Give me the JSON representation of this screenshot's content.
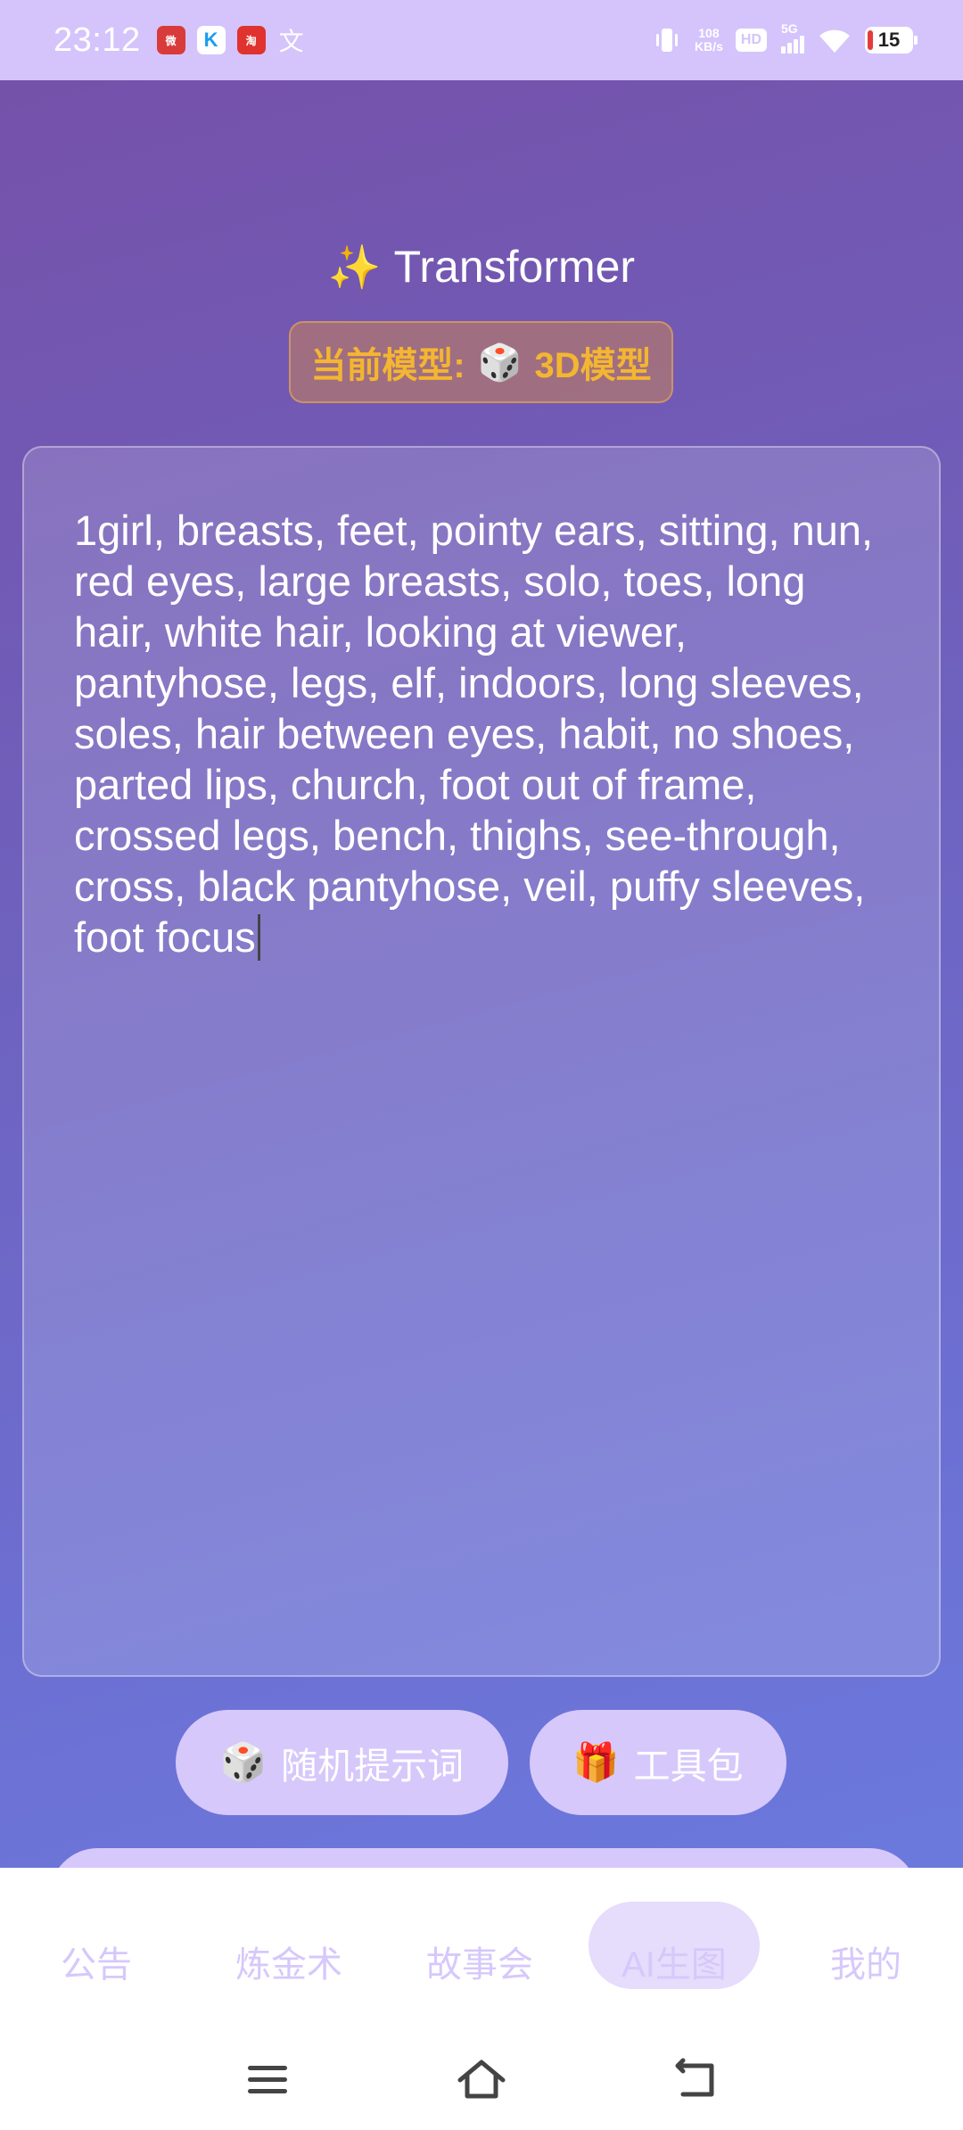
{
  "status_bar": {
    "time": "23:12",
    "network_speed_value": "108",
    "network_speed_unit": "KB/s",
    "hd_label": "HD",
    "signal_label": "5G",
    "battery_level": "15",
    "app_icons": [
      "weibo-icon",
      "kugou-icon",
      "taobao-icon",
      "translate-icon"
    ]
  },
  "header": {
    "title_emoji": "✨",
    "title": "Transformer",
    "model_label": "当前模型:",
    "model_emoji": "🎲",
    "model_value": "3D模型"
  },
  "prompt": {
    "text": "1girl, breasts, feet, pointy ears, sitting, nun, red eyes, large breasts, solo, toes, long hair, white hair, looking at viewer, pantyhose, legs, elf, indoors, long sleeves, soles, hair between eyes, habit, no shoes, parted lips, church, foot out of frame, crossed legs, bench, thighs, see-through, cross, black pantyhose, veil, puffy sleeves, foot focus"
  },
  "actions": {
    "random_emoji": "🎲",
    "random_label": "随机提示词",
    "tools_emoji": "🎁",
    "tools_label": "工具包"
  },
  "nav": {
    "tabs": [
      {
        "label": "公告"
      },
      {
        "label": "炼金术"
      },
      {
        "label": "故事会"
      },
      {
        "label": "AI生图"
      },
      {
        "label": "我的"
      }
    ],
    "active_index": 3
  },
  "colors": {
    "accent": "#d6c8fb",
    "badge_text": "#f4b531",
    "status_bar": "#d4c4fb"
  }
}
